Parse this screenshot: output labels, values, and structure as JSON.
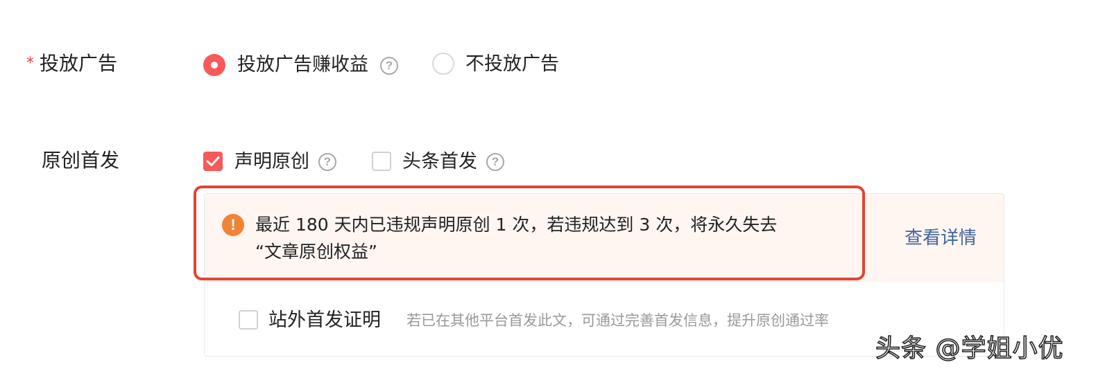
{
  "ad_row": {
    "required_mark": "*",
    "label": "投放广告",
    "options": [
      {
        "label": "投放广告赚收益",
        "selected": true,
        "has_help": true
      },
      {
        "label": "不投放广告",
        "selected": false,
        "has_help": false
      }
    ],
    "help_icon_glyph": "?"
  },
  "original_row": {
    "label": "原创首发",
    "options": [
      {
        "label": "声明原创",
        "checked": true,
        "has_help": true
      },
      {
        "label": "头条首发",
        "checked": false,
        "has_help": true
      }
    ],
    "help_icon_glyph": "?"
  },
  "warning": {
    "icon_glyph": "!",
    "line1": "最近 180 天内已违规声明原创 1 次，若违规达到 3 次，将永久失去",
    "line2": "“文章原创权益”",
    "link_label": "查看详情"
  },
  "offsite_proof": {
    "label": "站外首发证明",
    "checked": false,
    "hint": "若已在其他平台首发此文，可通过完善首发信息，提升原创通过率"
  },
  "watermark": {
    "text": "头条 @学姐小优"
  },
  "colors": {
    "accent": "#f85959",
    "warning_icon": "#f08336",
    "warning_bg": "#fff5f1",
    "link": "#406599",
    "highlight_border": "#e24432",
    "hint": "#999999"
  }
}
